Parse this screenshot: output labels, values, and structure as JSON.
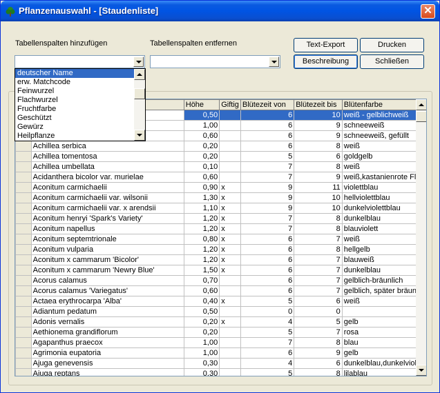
{
  "window": {
    "title": "Pflanzenauswahl - [Staudenliste]"
  },
  "controls": {
    "add_label": "Tabellenspalten hinzufügen",
    "remove_label": "Tabellenspalten entfernen",
    "add_combo_value": "",
    "remove_combo_value": ""
  },
  "buttons": {
    "text_export": "Text-Export",
    "print": "Drucken",
    "description": "Beschreibung",
    "close": "Schließen"
  },
  "dropdown": {
    "items": [
      "deutscher Name",
      "erw. Matchcode",
      "Feinwurzel",
      "Flachwurzel",
      "Fruchtfarbe",
      "Geschützt",
      "Gewürz",
      "Heilpflanze"
    ],
    "selected_index": 0
  },
  "table": {
    "columns": [
      "",
      "",
      "Höhe",
      "Giftig",
      "Blütezeit von",
      "Blütezeit bis",
      "Blütenfarbe"
    ],
    "rows": [
      [
        "",
        "",
        "0,50",
        "",
        "6",
        "10",
        "weiß - gelblichweiß"
      ],
      [
        "",
        "",
        "1,00",
        "",
        "6",
        "9",
        "schneeweiß"
      ],
      [
        "",
        "",
        "0,60",
        "",
        "6",
        "9",
        "schneeweiß, gefüllt"
      ],
      [
        "",
        "Achillea serbica",
        "0,20",
        "",
        "6",
        "8",
        "weiß"
      ],
      [
        "",
        "Achillea tomentosa",
        "0,20",
        "",
        "5",
        "6",
        "goldgelb"
      ],
      [
        "",
        "Achillea umbellata",
        "0,10",
        "",
        "7",
        "8",
        "weiß"
      ],
      [
        "",
        "Acidanthera bicolor var. murielae",
        "0,60",
        "",
        "7",
        "9",
        "weiß,kastanienrote Flec"
      ],
      [
        "",
        "Aconitum carmichaelii",
        "0,90",
        "x",
        "9",
        "11",
        "violettblau"
      ],
      [
        "",
        "Aconitum carmichaelii var. wilsonii",
        "1,30",
        "x",
        "9",
        "10",
        "hellviolettblau"
      ],
      [
        "",
        "Aconitum carmichaelii var. x arendsii",
        "1,10",
        "x",
        "9",
        "10",
        "dunkelviolettblau"
      ],
      [
        "",
        "Aconitum henryi 'Spark's Variety'",
        "1,20",
        "x",
        "7",
        "8",
        "dunkelblau"
      ],
      [
        "",
        "Aconitum napellus",
        "1,20",
        "x",
        "7",
        "8",
        "blauviolett"
      ],
      [
        "",
        "Aconitum septemtrionale",
        "0,80",
        "x",
        "6",
        "7",
        "weiß"
      ],
      [
        "",
        "Aconitum vulparia",
        "1,20",
        "x",
        "6",
        "8",
        "hellgelb"
      ],
      [
        "",
        "Aconitum x cammarum 'Bicolor'",
        "1,20",
        "x",
        "6",
        "7",
        "blauweiß"
      ],
      [
        "",
        "Aconitum x cammarum 'Newry Blue'",
        "1,50",
        "x",
        "6",
        "7",
        "dunkelblau"
      ],
      [
        "",
        "Acorus calamus",
        "0,70",
        "",
        "6",
        "7",
        "gelblich-bräunlich"
      ],
      [
        "",
        "Acorus calamus 'Variegatus'",
        "0,60",
        "",
        "6",
        "7",
        "gelblich, später bräunlic"
      ],
      [
        "",
        "Actaea erythrocarpa 'Alba'",
        "0,40",
        "x",
        "5",
        "6",
        "weiß"
      ],
      [
        "",
        "Adiantum pedatum",
        "0,50",
        "",
        "0",
        "0",
        ""
      ],
      [
        "",
        "Adonis vernalis",
        "0,20",
        "x",
        "4",
        "5",
        "gelb"
      ],
      [
        "",
        "Aethionema grandiflorum",
        "0,20",
        "",
        "5",
        "7",
        "rosa"
      ],
      [
        "",
        "Agapanthus praecox",
        "1,00",
        "",
        "7",
        "8",
        "blau"
      ],
      [
        "",
        "Agrimonia eupatoria",
        "1,00",
        "",
        "6",
        "9",
        "gelb"
      ],
      [
        "",
        "Ajuga genevensis",
        "0,30",
        "",
        "4",
        "6",
        "dunkelblau,dunkelviolet"
      ],
      [
        "",
        "Ajuga reptans",
        "0,30",
        "",
        "5",
        "8",
        "lilablau"
      ]
    ],
    "selected_row": 0
  },
  "colors": {
    "selection": "#316ac5",
    "titlebar": "#0054e3",
    "close_button": "#d94a1c"
  }
}
